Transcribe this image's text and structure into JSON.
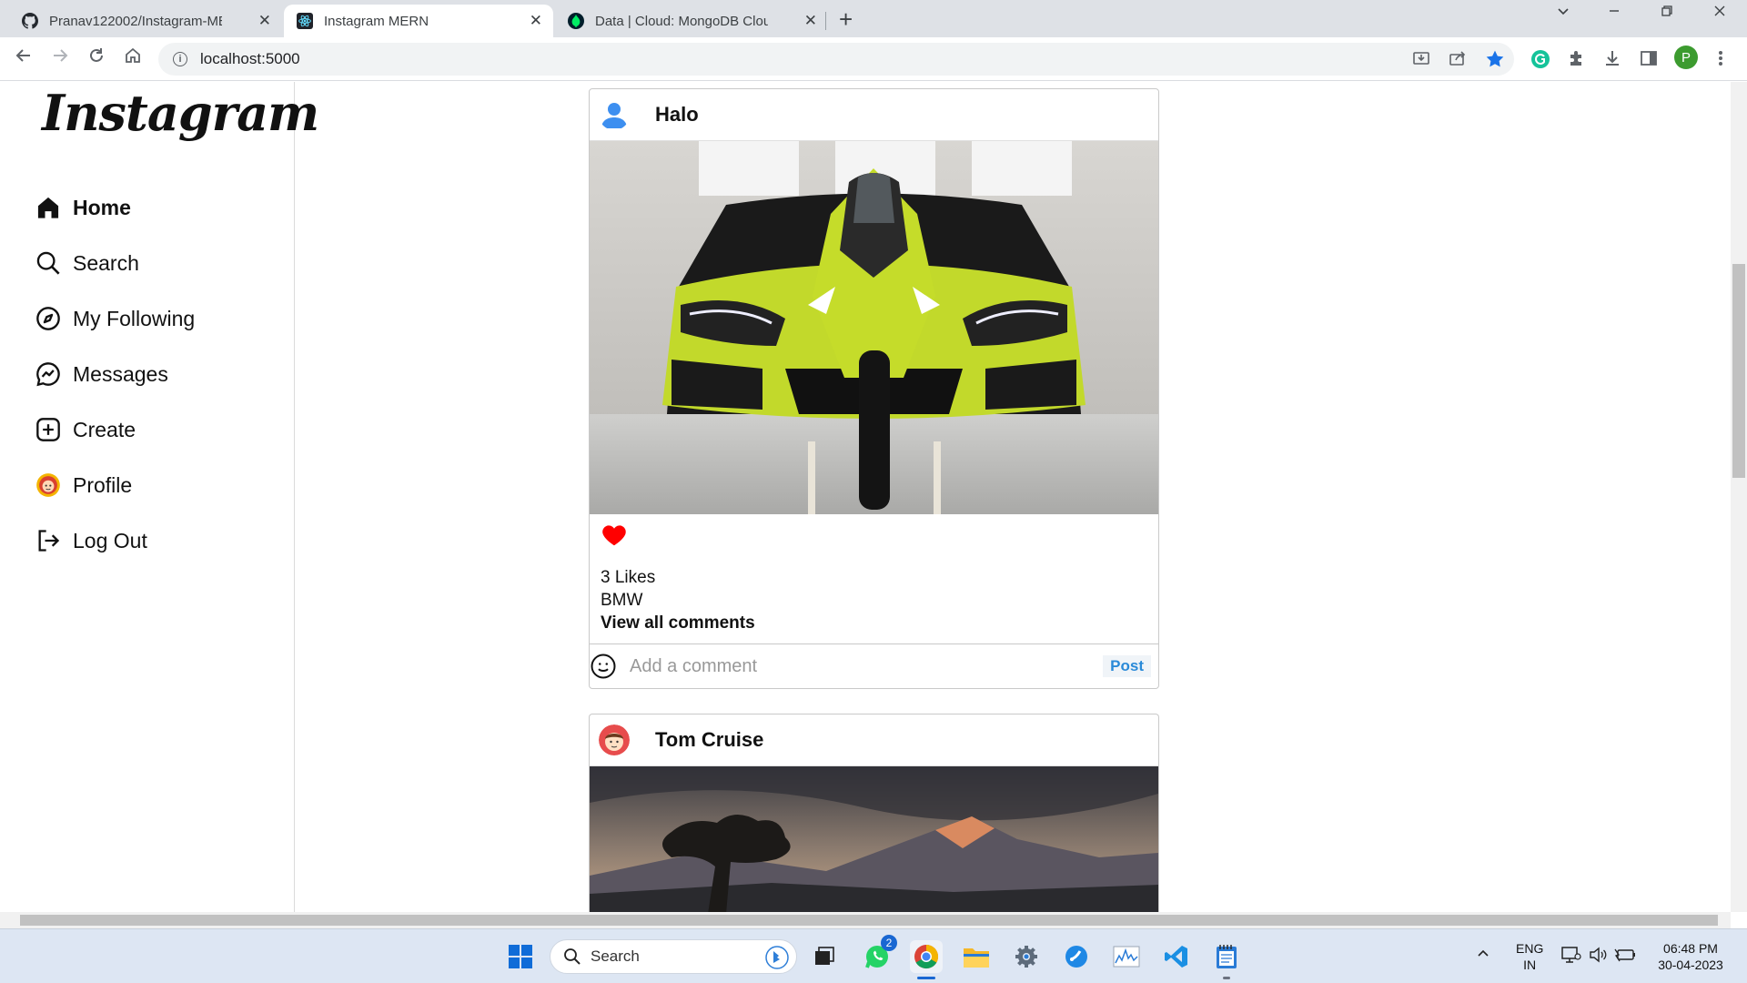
{
  "browser": {
    "tabs": [
      {
        "label": "Pranav122002/Instagram-MERN:",
        "icon": "github-icon"
      },
      {
        "label": "Instagram MERN",
        "icon": "react-icon"
      },
      {
        "label": "Data | Cloud: MongoDB Cloud",
        "icon": "mongodb-icon"
      }
    ],
    "url": "localhost:5000",
    "profile_initial": "P"
  },
  "sidebar": {
    "logo": "Instagram",
    "items": [
      {
        "label": "Home",
        "icon": "home-icon"
      },
      {
        "label": "Search",
        "icon": "search-icon"
      },
      {
        "label": "My Following",
        "icon": "compass-icon"
      },
      {
        "label": "Messages",
        "icon": "messenger-icon"
      },
      {
        "label": "Create",
        "icon": "plus-square-icon"
      },
      {
        "label": "Profile",
        "icon": "profile-avatar-icon"
      },
      {
        "label": "Log Out",
        "icon": "logout-icon"
      }
    ]
  },
  "feed": {
    "posts": [
      {
        "author": "Halo",
        "likes": "3 Likes",
        "caption": "BMW",
        "view_comments": "View all comments",
        "comment_placeholder": "Add a comment",
        "post_label": "Post",
        "liked": true
      },
      {
        "author": "Tom Cruise"
      }
    ]
  },
  "taskbar": {
    "search_label": "Search",
    "whatsapp_badge": "2",
    "lang_top": "ENG",
    "lang_bottom": "IN",
    "time": "06:48 PM",
    "date": "30-04-2023"
  },
  "colors": {
    "heart": "#ff0000",
    "post_link": "#2a8ad8",
    "active_tab": "#ffffff",
    "tabstrip": "#dee1e6"
  }
}
